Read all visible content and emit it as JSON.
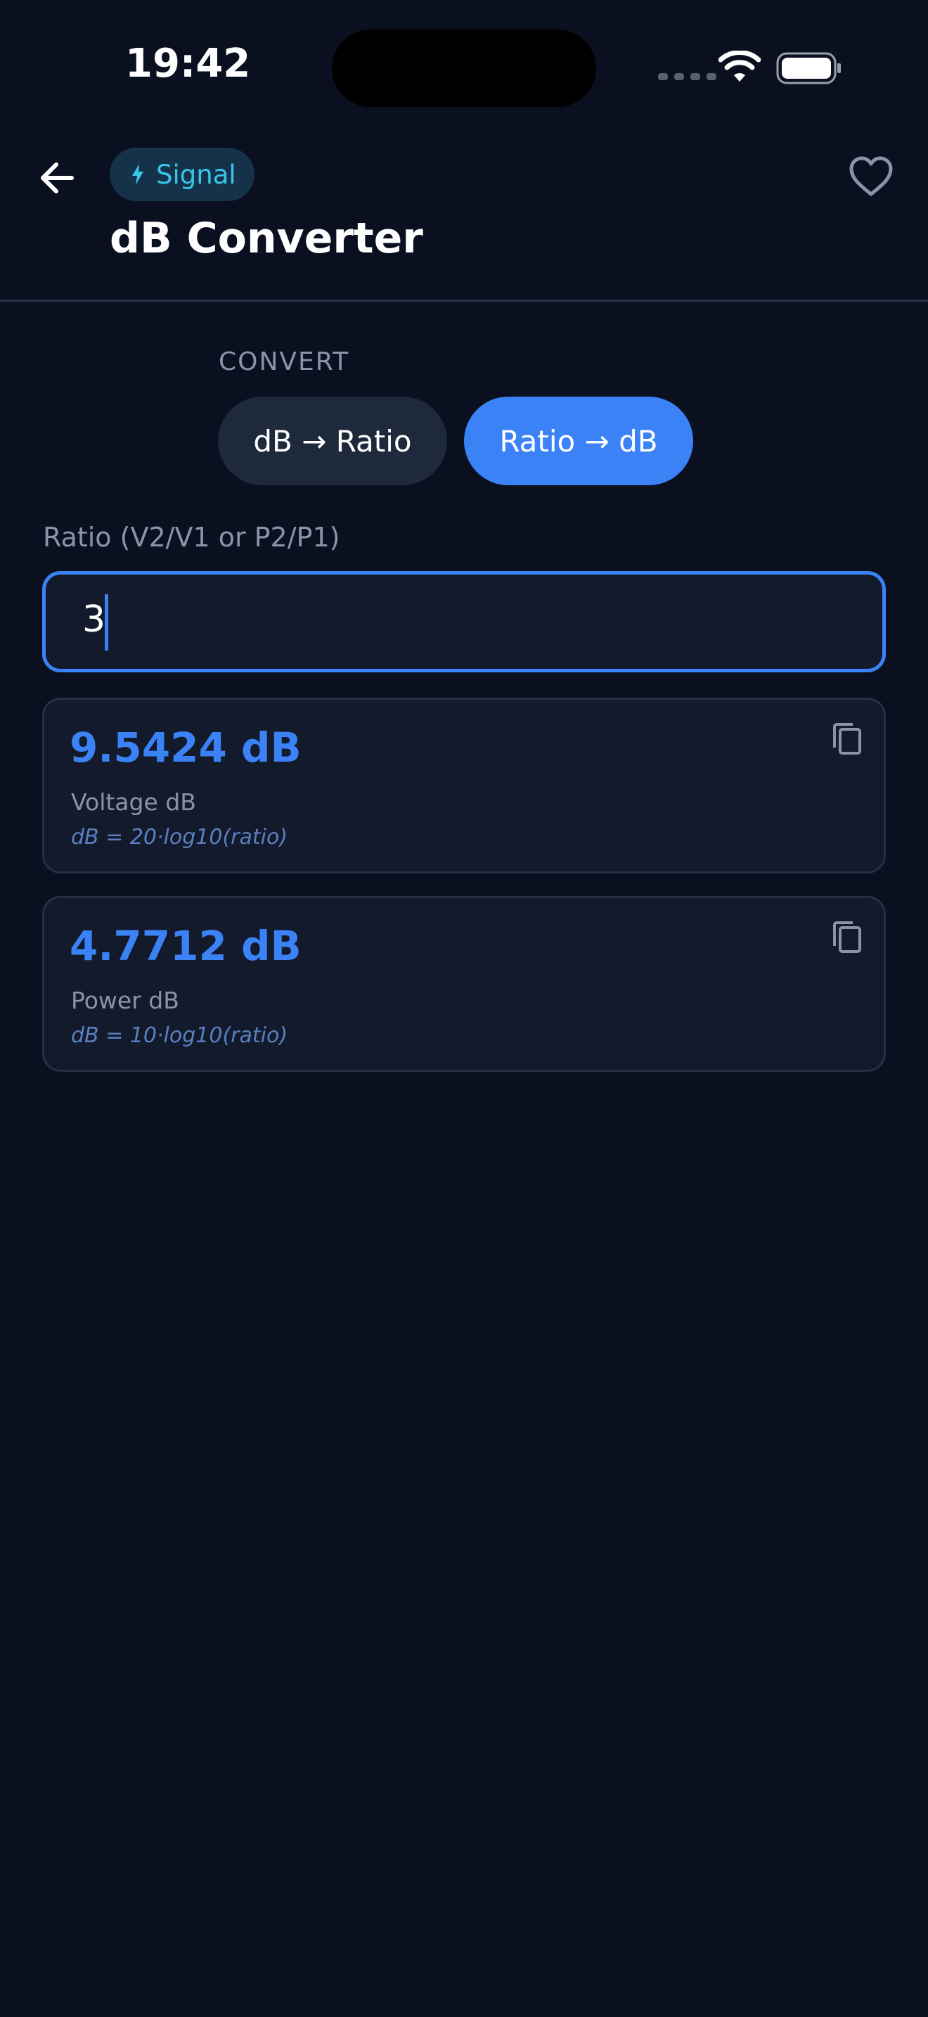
{
  "status_bar": {
    "time": "19:42"
  },
  "header": {
    "category_chip": "Signal",
    "title": "dB Converter"
  },
  "convert": {
    "section_label": "CONVERT",
    "options": [
      {
        "label": "dB → Ratio",
        "selected": false
      },
      {
        "label": "Ratio → dB",
        "selected": true
      }
    ]
  },
  "input": {
    "label": "Ratio (V2/V1 or P2/P1)",
    "value": "3"
  },
  "results": [
    {
      "value": "9.5424 dB",
      "label": "Voltage dB",
      "formula": "dB = 20·log10(ratio)"
    },
    {
      "value": "4.7712 dB",
      "label": "Power dB",
      "formula": "dB = 10·log10(ratio)"
    }
  ],
  "colors": {
    "background": "#0b1020",
    "accent": "#3b82f6",
    "chip_text": "#38c6e8",
    "card": "#121a2b"
  },
  "icons": {
    "back": "arrow-left-icon",
    "chip": "lightning-bolt-icon",
    "favorite": "heart-outline-icon",
    "copy": "copy-icon"
  }
}
